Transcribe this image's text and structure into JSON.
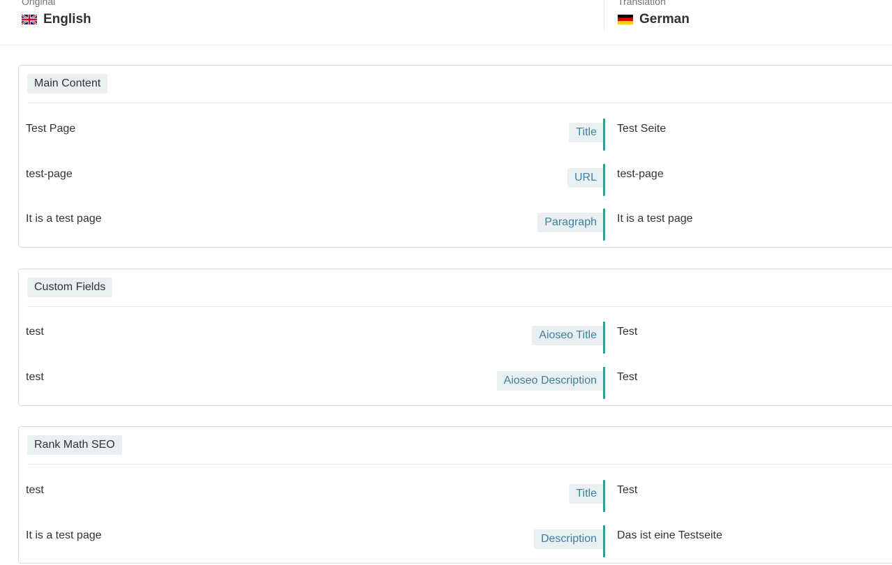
{
  "header": {
    "original": {
      "caption": "Original",
      "language": "English",
      "flag_icon": "uk-flag-icon"
    },
    "translation": {
      "caption": "Translation",
      "language": "German",
      "flag_icon": "german-flag-icon"
    }
  },
  "sections": [
    {
      "title": "Main Content",
      "rows": [
        {
          "original": "Test Page",
          "label": "Title",
          "translation": "Test Seite"
        },
        {
          "original": "test-page",
          "label": "URL",
          "translation": "test-page"
        },
        {
          "original": "It is a test page",
          "label": "Paragraph",
          "translation": "It is a test page"
        }
      ]
    },
    {
      "title": "Custom Fields",
      "rows": [
        {
          "original": "test",
          "label": "Aioseo Title",
          "translation": "Test"
        },
        {
          "original": "test",
          "label": "Aioseo Description",
          "translation": "Test"
        }
      ]
    },
    {
      "title": "Rank Math SEO",
      "rows": [
        {
          "original": "test",
          "label": "Title",
          "translation": "Test"
        },
        {
          "original": "It is a test page",
          "label": "Description",
          "translation": "Das ist eine Testseite"
        }
      ]
    }
  ],
  "colors": {
    "accent_bar": "#2aa38c",
    "label_bg": "#eaf0f2",
    "label_text": "#3f7fa0"
  }
}
